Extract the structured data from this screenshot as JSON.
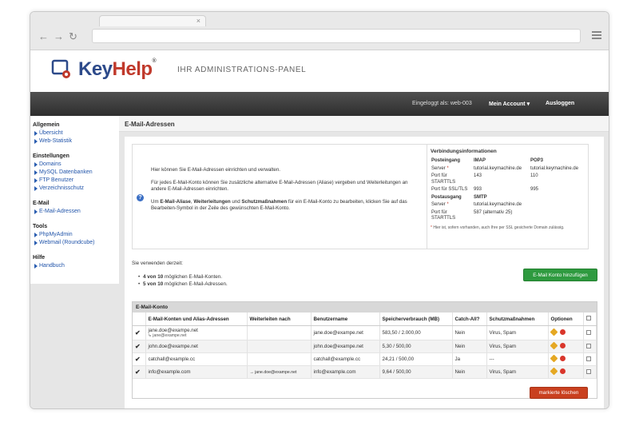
{
  "browser": {
    "tab_close": "×"
  },
  "header": {
    "logo_key": "Key",
    "logo_help": "Help",
    "logo_reg": "®",
    "tagline": "IHR ADMINISTRATIONS-PANEL"
  },
  "topbar": {
    "logged_in": "Eingeloggt als: web-003",
    "account": "Mein Account ▾",
    "logout": "Ausloggen"
  },
  "sidebar": {
    "groups": [
      {
        "title": "Allgemein",
        "items": [
          "Übersicht",
          "Web-Statistik"
        ]
      },
      {
        "title": "Einstellungen",
        "items": [
          "Domains",
          "MySQL Datenbanken",
          "FTP Benutzer",
          "Verzeichnisschutz"
        ]
      },
      {
        "title": "E-Mail",
        "items": [
          "E-Mail-Adressen"
        ]
      },
      {
        "title": "Tools",
        "items": [
          "PhpMyAdmin",
          "Webmail (Roundcube)"
        ]
      },
      {
        "title": "Hilfe",
        "items": [
          "Handbuch"
        ]
      }
    ]
  },
  "page": {
    "title": "E-Mail-Adressen"
  },
  "intro": {
    "line1": "Hier können Sie E-Mail-Adressen einrichten und verwalten.",
    "line2": "Für jedes E-Mail-Konto können Sie zusätzliche alternative E-Mail-Adressen (Aliase) vergeben und Weiterleitungen an andere E-Mail-Adressen einrichten.",
    "line3_pre": "Um ",
    "line3_bold1": "E-Mail-Aliase",
    "line3_sep1": ", ",
    "line3_bold2": "Weiterleitungen",
    "line3_sep2": " und ",
    "line3_bold3": "Schutzmaßnahmen",
    "line3_post": " für ein E-Mail-Konto zu bearbeiten, klicken Sie auf das Bearbeiten-Symbol in der Zeile des gewünschten E-Mail-Konto."
  },
  "connection": {
    "title": "Verbindungsinformationen",
    "incoming": "Posteingang",
    "imap": "IMAP",
    "pop3": "POP3",
    "server": "Server",
    "imap_server": "tutorial.keymachine.de",
    "pop3_server": "tutorial.keymachine.de",
    "port_starttls": "Port für STARTTLS",
    "imap_starttls": "143",
    "pop3_starttls": "110",
    "port_ssl": "Port für SSL/TLS",
    "imap_ssl": "993",
    "pop3_ssl": "995",
    "outgoing": "Postausgang",
    "smtp": "SMTP",
    "smtp_server": "tutorial.keymachine.de",
    "smtp_starttls": "587 (alternativ 25)",
    "footnote": "Hier ist, sofern vorhanden, auch Ihre per SSL gesicherte Domain zulässig."
  },
  "usage": {
    "intro": "Sie verwenden derzeit:",
    "accounts_bold": "4 von 10",
    "accounts_text": " möglichen E-Mail-Konten.",
    "addresses_bold": "5 von 10",
    "addresses_text": " möglichen E-Mail-Adressen.",
    "add_button": "E-Mail Konto hinzufügen"
  },
  "table": {
    "title": "E-Mail-Konto",
    "columns": [
      "E-Mail-Konten und Alias-Adressen",
      "Weiterleiten nach",
      "Benutzername",
      "Speicherverbrauch (MB)",
      "Catch-All?",
      "Schutzmaßnahmen",
      "Optionen"
    ],
    "rows": [
      {
        "email": "jane.doe@exampe.net",
        "alias": "↳ jane@exampe.net",
        "forward": "",
        "username": "jane.doe@exampe.net",
        "storage": "583,50 / 2.000,00",
        "catchall": "Nein",
        "protection": "Virus, Spam"
      },
      {
        "email": "john.doe@exampe.net",
        "alias": "",
        "forward": "",
        "username": "john.doe@exampe.net",
        "storage": "5,30 / 500,00",
        "catchall": "Nein",
        "protection": "Virus, Spam"
      },
      {
        "email": "catchall@example.cc",
        "alias": "",
        "forward": "",
        "username": "catchall@example.cc",
        "storage": "24,21 / 500,00",
        "catchall": "Ja",
        "protection": "---"
      },
      {
        "email": "info@example.com",
        "alias": "",
        "forward": "→ jane.doe@exampe.net",
        "username": "info@example.com",
        "storage": "9,64 / 500,00",
        "catchall": "Nein",
        "protection": "Virus, Spam"
      }
    ],
    "check_glyph": "✔",
    "delete_button": "markierte löschen"
  },
  "colors": {
    "accent_green": "#2e9a3f",
    "danger": "#c9401f",
    "link": "#2255aa"
  }
}
